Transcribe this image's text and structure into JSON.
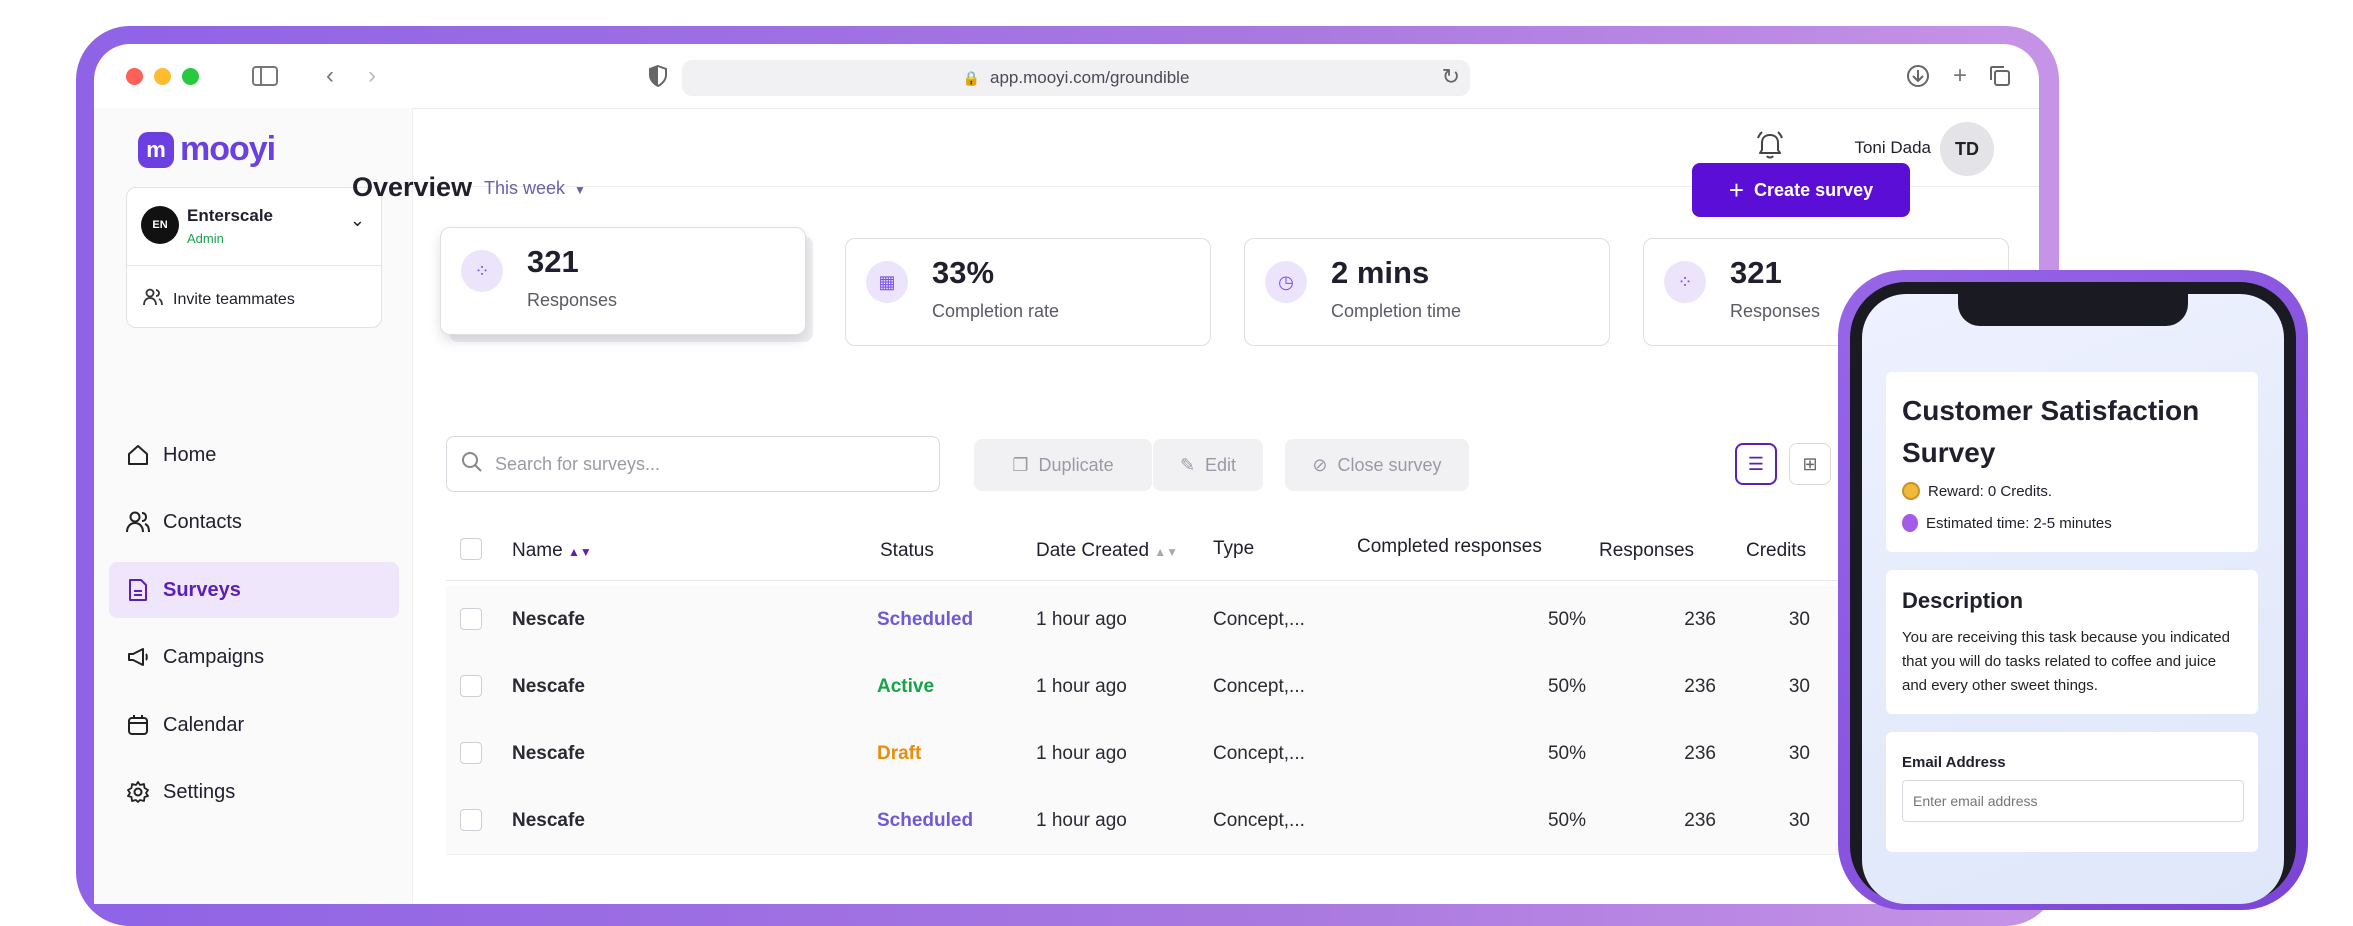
{
  "browser": {
    "url": "app.mooyi.com/groundible"
  },
  "brand": {
    "logo_text": "mooyi",
    "logo_mark": "m"
  },
  "org": {
    "initials": "EN",
    "name": "Enterscale",
    "role": "Admin",
    "invite_label": "Invite teammates"
  },
  "nav": [
    {
      "label": "Home",
      "icon": "home-icon"
    },
    {
      "label": "Contacts",
      "icon": "contacts-icon"
    },
    {
      "label": "Surveys",
      "icon": "surveys-icon",
      "active": true
    },
    {
      "label": "Campaigns",
      "icon": "megaphone-icon"
    },
    {
      "label": "Calendar",
      "icon": "calendar-icon"
    },
    {
      "label": "Settings",
      "icon": "gear-icon"
    }
  ],
  "user": {
    "name": "Toni Dada",
    "initials": "TD"
  },
  "overview": {
    "title": "Overview",
    "period": "This week",
    "create_label": "Create survey"
  },
  "stats": [
    {
      "value": "321",
      "label": "Responses"
    },
    {
      "value": "33%",
      "label": "Completion rate"
    },
    {
      "value": "2 mins",
      "label": "Completion time"
    },
    {
      "value": "321",
      "label": "Responses"
    }
  ],
  "toolbar": {
    "search_placeholder": "Search for surveys...",
    "duplicate_label": "Duplicate",
    "edit_label": "Edit",
    "close_label": "Close survey"
  },
  "table": {
    "columns": [
      "Name",
      "Status",
      "Date Created",
      "Type",
      "Completed responses",
      "Responses",
      "Credits"
    ],
    "rows": [
      {
        "name": "Nescafe",
        "status": "Scheduled",
        "date": "1 hour ago",
        "type": "Concept,...",
        "completed": "50%",
        "responses": "236",
        "credits": "30"
      },
      {
        "name": "Nescafe",
        "status": "Active",
        "date": "1 hour ago",
        "type": "Concept,...",
        "completed": "50%",
        "responses": "236",
        "credits": "30"
      },
      {
        "name": "Nescafe",
        "status": "Draft",
        "date": "1 hour ago",
        "type": "Concept,...",
        "completed": "50%",
        "responses": "236",
        "credits": "30"
      },
      {
        "name": "Nescafe",
        "status": "Scheduled",
        "date": "1 hour ago",
        "type": "Concept,...",
        "completed": "50%",
        "responses": "236",
        "credits": "30"
      }
    ]
  },
  "status_colors": {
    "Scheduled": "#6d5ad6",
    "Active": "#16a34a",
    "Draft": "#ea8c0c"
  },
  "phone": {
    "survey_title": "Customer Satisfaction Survey",
    "reward_label": "Reward:",
    "reward_value": "0 Credits.",
    "time_label": "Estimated time:",
    "time_value": "2-5 minutes",
    "description_title": "Description",
    "description_text": "You are receiving this task because you indicated that you will do tasks related to coffee and juice and every other sweet things.",
    "email_label": "Email Address",
    "email_placeholder": "Enter email address"
  }
}
